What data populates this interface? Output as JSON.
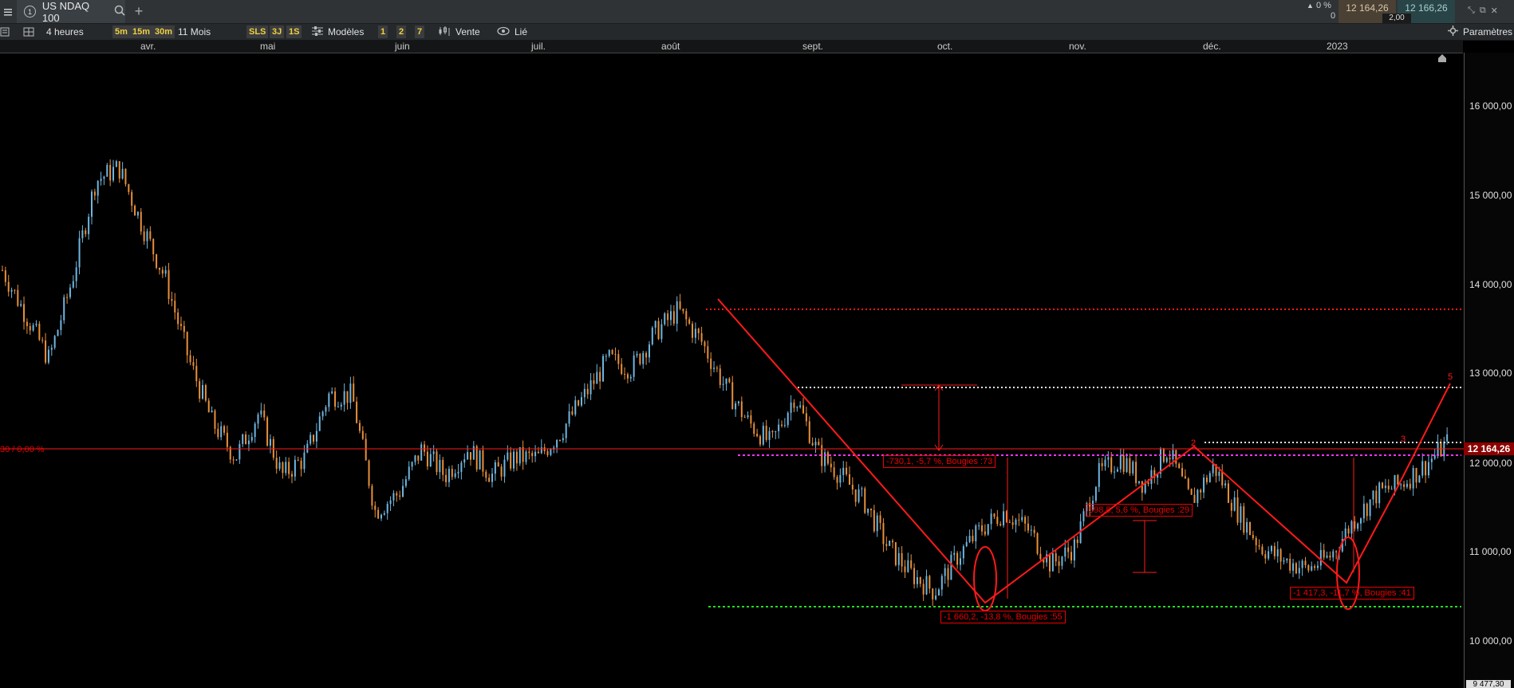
{
  "app": {
    "tab_number": "1",
    "instrument": "US NDAQ 100"
  },
  "quote": {
    "change_pct": "0 %",
    "change_points": "0",
    "bid": "12 164,26",
    "ask": "12 166,26",
    "spread": "2,00"
  },
  "toolbar": {
    "timeframe": "4 heures",
    "tf_5m": "5m",
    "tf_15m": "15m",
    "tf_30m": "30m",
    "period": "11 Mois",
    "btn_sls": "SLS",
    "btn_3j": "3J",
    "btn_1s": "1S",
    "models": "Modèles",
    "q1": "1",
    "q2": "2",
    "q7": "7",
    "sell": "Vente",
    "linked": "Lié",
    "settings": "Paramètres"
  },
  "months": [
    "avr.",
    "mai",
    "juin",
    "juil.",
    "août",
    "sept.",
    "oct.",
    "nov.",
    "déc.",
    "2023"
  ],
  "price_axis": [
    "16 000,00",
    "15 000,00",
    "14 000,00",
    "13 000,00",
    "12 000,00",
    "11 000,00",
    "10 000,00",
    "9 477,30"
  ],
  "current_price": "12 164,26",
  "left_price_label": "30 / 0,00 %",
  "annotations": {
    "a1": "-730,1, -5,7 %, Bougies :73",
    "a2": "598,8, 5,6 %, Bougies :29",
    "a3": "-1 660,2, -13,8 %, Bougies :55",
    "a4": "-1 417,3, -11,7 %, Bougies :41",
    "w2": "2",
    "w5": "5",
    "w3": "3"
  },
  "colors": {
    "up_candle": "#6fb6e0",
    "down_candle": "#e8903a",
    "drawing": "#ff1a1a",
    "magenta": "#ff33ff",
    "green": "#22dd22",
    "white_dots": "#e0e0e0"
  },
  "chart_data": {
    "type": "candlestick",
    "title": "US NDAQ 100",
    "interval": "4 heures",
    "x_months": [
      "avr.",
      "mai",
      "juin",
      "juil.",
      "août",
      "sept.",
      "oct.",
      "nov.",
      "déc.",
      "2023"
    ],
    "ylim": [
      9477.3,
      16600
    ],
    "yticks": [
      16000,
      15000,
      14000,
      13000,
      12000,
      11000,
      10000
    ],
    "last_price": 12164.26,
    "close_path": [
      [
        0,
        14100
      ],
      [
        1,
        13600
      ],
      [
        2,
        13100
      ],
      [
        3,
        14000
      ],
      [
        4,
        15100
      ],
      [
        5,
        15250
      ],
      [
        6,
        14600
      ],
      [
        7,
        14000
      ],
      [
        8,
        13100
      ],
      [
        9,
        12400
      ],
      [
        10,
        12000
      ],
      [
        11,
        12500
      ],
      [
        12,
        11800
      ],
      [
        13,
        12000
      ],
      [
        14,
        12700
      ],
      [
        15,
        12700
      ],
      [
        16,
        11400
      ],
      [
        17,
        11600
      ],
      [
        18,
        12100
      ],
      [
        19,
        11800
      ],
      [
        20,
        12100
      ],
      [
        21,
        11800
      ],
      [
        22,
        12000
      ],
      [
        23,
        12000
      ],
      [
        24,
        12300
      ],
      [
        25,
        12700
      ],
      [
        26,
        13100
      ],
      [
        27,
        13000
      ],
      [
        28,
        13400
      ],
      [
        29,
        13650
      ],
      [
        30,
        13300
      ],
      [
        31,
        12800
      ],
      [
        32,
        12400
      ],
      [
        33,
        12150
      ],
      [
        34,
        12700
      ],
      [
        35,
        12050
      ],
      [
        36,
        11800
      ],
      [
        37,
        11500
      ],
      [
        38,
        11000
      ],
      [
        39,
        10700
      ],
      [
        40,
        10500
      ],
      [
        41,
        10900
      ],
      [
        42,
        11200
      ],
      [
        43,
        11400
      ],
      [
        44,
        11200
      ],
      [
        45,
        10800
      ],
      [
        46,
        11000
      ],
      [
        47,
        11800
      ],
      [
        48,
        12000
      ],
      [
        49,
        11700
      ],
      [
        50,
        12100
      ],
      [
        51,
        11500
      ],
      [
        52,
        11900
      ],
      [
        53,
        11400
      ],
      [
        54,
        11000
      ],
      [
        55,
        10850
      ],
      [
        56,
        10750
      ],
      [
        57,
        10900
      ],
      [
        58,
        11300
      ],
      [
        59,
        11600
      ],
      [
        60,
        11700
      ],
      [
        61,
        11900
      ],
      [
        62,
        12164
      ]
    ],
    "horizontal_levels": [
      {
        "price": 13700,
        "style": "red dotted"
      },
      {
        "price": 12850,
        "style": "white dotted"
      },
      {
        "price": 12200,
        "style": "white dotted"
      },
      {
        "price": 12140,
        "style": "red solid"
      },
      {
        "price": 12080,
        "style": "magenta dotted"
      },
      {
        "price": 10400,
        "style": "green dotted"
      }
    ]
  }
}
